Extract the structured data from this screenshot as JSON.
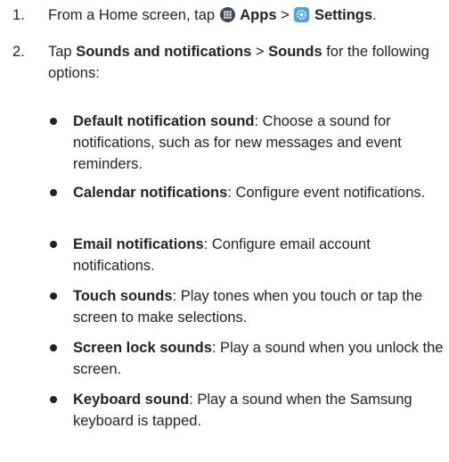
{
  "steps": [
    {
      "number": "1.",
      "prefix": "From a Home screen, tap",
      "apps_icon": "apps-grid-icon",
      "apps_label": "Apps",
      "sep": ">",
      "settings_icon": "settings-gear-icon",
      "settings_label": "Settings",
      "suffix": "."
    },
    {
      "number": "2.",
      "prefix": "Tap",
      "item1": "Sounds and notifications",
      "sep": ">",
      "item2": "Sounds",
      "suffix": "for the following options:"
    }
  ],
  "bullets": [
    {
      "term": "Default notification sound",
      "desc": ": Choose a sound for notifications, such as for new messages and event reminders."
    },
    {
      "term": "Calendar notifications",
      "desc": ": Configure event notifications."
    },
    {
      "term": "Email notifications",
      "desc": ": Configure email account notifications."
    },
    {
      "term": "Touch sounds",
      "desc": ": Play tones when you touch or tap the screen to make selections."
    },
    {
      "term": "Screen lock sounds",
      "desc": ": Play a sound when you unlock the screen."
    },
    {
      "term": "Keyboard sound",
      "desc": ": Play a sound when the Samsung keyboard is tapped."
    }
  ],
  "colors": {
    "text": "#222222",
    "apps_icon_bg": "#3f4a52",
    "settings_icon_bg": "#4aa3df"
  }
}
